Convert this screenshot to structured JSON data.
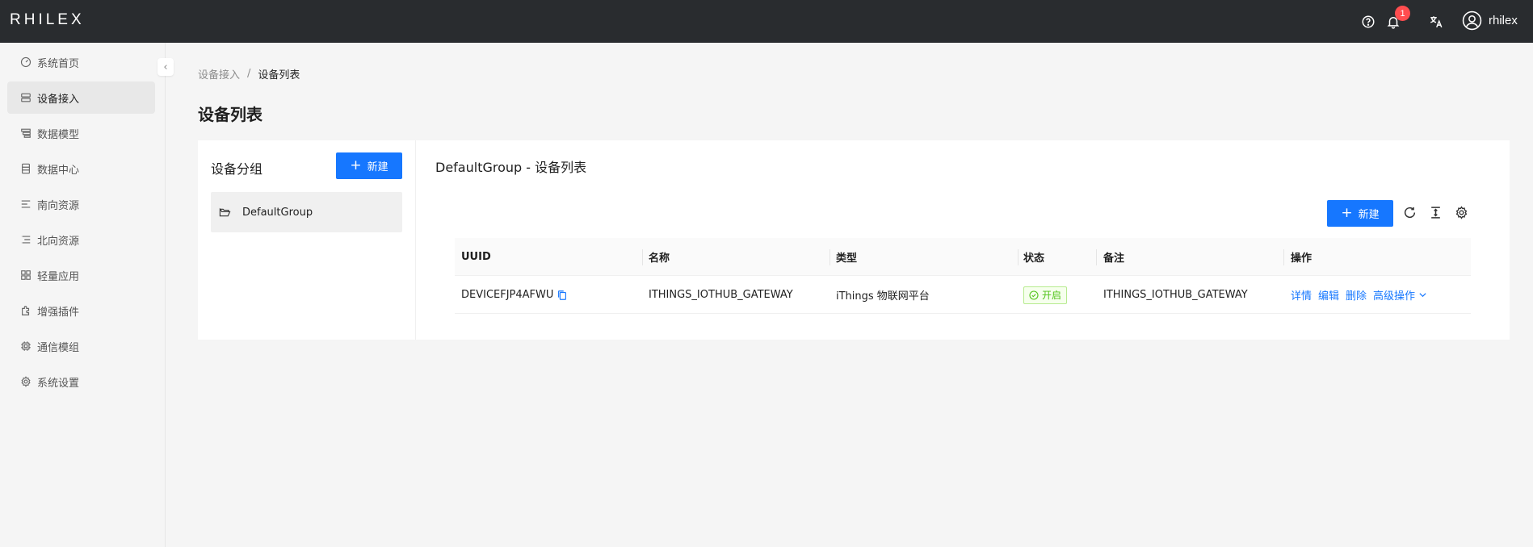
{
  "header": {
    "logo": "RHILEX",
    "notification_count": "1",
    "username": "rhilex",
    "icons": [
      "help-icon",
      "bell-icon",
      "translate-icon",
      "user-avatar-icon"
    ]
  },
  "sidebar": {
    "items": [
      {
        "label": "系统首页",
        "icon": "dashboard-icon"
      },
      {
        "label": "设备接入",
        "icon": "device-icon",
        "active": true
      },
      {
        "label": "数据模型",
        "icon": "model-icon"
      },
      {
        "label": "数据中心",
        "icon": "database-icon"
      },
      {
        "label": "南向资源",
        "icon": "south-icon"
      },
      {
        "label": "北向资源",
        "icon": "north-icon"
      },
      {
        "label": "轻量应用",
        "icon": "app-icon"
      },
      {
        "label": "增强插件",
        "icon": "plugin-icon"
      },
      {
        "label": "通信模组",
        "icon": "chip-icon"
      },
      {
        "label": "系统设置",
        "icon": "gear-icon"
      }
    ]
  },
  "breadcrumb": {
    "parent": "设备接入",
    "separator": "/",
    "current": "设备列表"
  },
  "page": {
    "title": "设备列表"
  },
  "groups": {
    "title": "设备分组",
    "new_label": "新建",
    "items": [
      {
        "label": "DefaultGroup"
      }
    ]
  },
  "device_list": {
    "title": "DefaultGroup - 设备列表",
    "new_label": "新建",
    "columns": [
      "UUID",
      "名称",
      "类型",
      "状态",
      "备注",
      "操作"
    ],
    "rows": [
      {
        "uuid": "DEVICEFJP4AFWU",
        "name": "ITHINGS_IOTHUB_GATEWAY",
        "type": "iThings 物联网平台",
        "status": "开启",
        "remark": "ITHINGS_IOTHUB_GATEWAY",
        "actions": [
          "详情",
          "编辑",
          "删除"
        ],
        "more": "高级操作"
      }
    ]
  },
  "colors": {
    "header_bg": "#292c2f",
    "primary": "#1677ff",
    "success": "#52c41a",
    "badge": "#ff4d4f"
  }
}
